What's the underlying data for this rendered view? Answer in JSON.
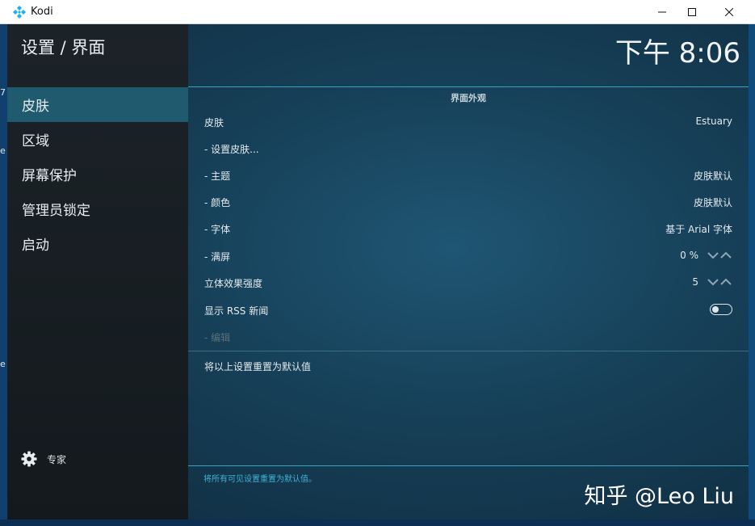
{
  "window": {
    "title": "Kodi",
    "minimize_glyph": "—",
    "maximize_glyph": "☐",
    "close_glyph": "✕"
  },
  "desktop": {
    "edge_chars": [
      "7",
      "e",
      "e"
    ]
  },
  "header": {
    "breadcrumb": "设置 / 界面",
    "clock": "下午 8:06"
  },
  "sidebar": {
    "items": [
      {
        "label": "皮肤",
        "active": true
      },
      {
        "label": "区域",
        "active": false
      },
      {
        "label": "屏幕保护",
        "active": false
      },
      {
        "label": "管理员锁定",
        "active": false
      },
      {
        "label": "启动",
        "active": false
      }
    ],
    "settings_level": {
      "label": "专家",
      "icon": "gear-icon"
    }
  },
  "main": {
    "section_title": "界面外观",
    "rows": [
      {
        "label": "皮肤",
        "value": "Estuary"
      },
      {
        "label": "- 设置皮肤..."
      },
      {
        "label": "- 主题",
        "value": "皮肤默认"
      },
      {
        "label": "- 颜色",
        "value": "皮肤默认"
      },
      {
        "label": "- 字体",
        "value": "基于 Arial 字体"
      },
      {
        "label": "- 满屏",
        "value": "0 %"
      },
      {
        "label": "立体效果强度",
        "value": "5"
      },
      {
        "label": "显示 RSS 新闻",
        "toggle": false
      },
      {
        "label": "- 编辑",
        "disabled": true
      }
    ],
    "reset_label": "将以上设置重置为默认值",
    "help_text": "将所有可见设置重置为默认值。"
  },
  "watermark": "知乎 @Leo Liu",
  "colors": {
    "accent_line": "#3aa3c0",
    "active_item": "#1f5a6e",
    "help_text": "#3fb2d6"
  }
}
